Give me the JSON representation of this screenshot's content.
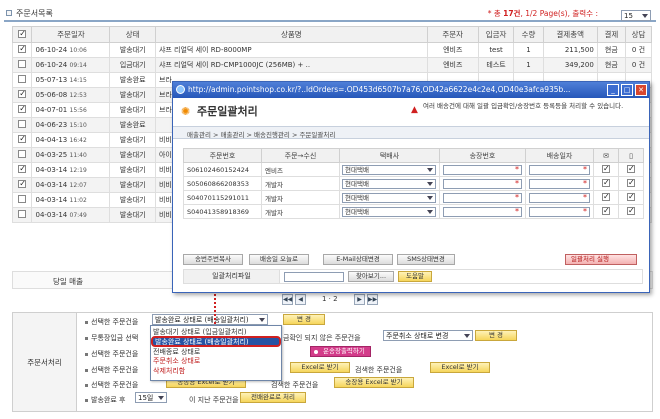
{
  "header": {
    "title": "주문서목록",
    "total_prefix": "* 총 ",
    "total_count": "17건",
    "total_pages": ", 1/2 Page(s), 출력수 : ",
    "per_page": "15"
  },
  "table": {
    "columns": [
      "주문일자",
      "상태",
      "상품명",
      "주문자",
      "입금자",
      "수량",
      "결제총액",
      "결제",
      "상담"
    ],
    "rows": [
      {
        "checked": true,
        "date": "06-10-24",
        "time": "10:06",
        "status": "발송대기",
        "product": "샤프 리얼덕 세이 RD-8000MP",
        "buyer": "엔비즈",
        "payer": "test",
        "qty": "1",
        "total": "211,500",
        "pay": "현금",
        "memo": "0 건"
      },
      {
        "checked": false,
        "date": "06-10-24",
        "time": "09:14",
        "status": "입금대기",
        "product": "샤프 리얼덕 세이 RD-CMP1000JC (256MB) + ..",
        "buyer": "엔비즈",
        "payer": "테스트",
        "qty": "1",
        "total": "349,200",
        "pay": "현금",
        "memo": "0 건"
      },
      {
        "checked": false,
        "date": "05-07-13",
        "time": "14:15",
        "status": "발송완료",
        "product": "브라",
        "buyer": "",
        "payer": "",
        "qty": "",
        "total": "",
        "pay": "",
        "memo": ""
      },
      {
        "checked": true,
        "date": "05-06-08",
        "time": "12:53",
        "status": "발송대기",
        "product": "브라",
        "buyer": "",
        "payer": "",
        "qty": "",
        "total": "",
        "pay": "",
        "memo": ""
      },
      {
        "checked": true,
        "date": "04-07-01",
        "time": "15:56",
        "status": "발송대기",
        "product": "브라",
        "buyer": "",
        "payer": "",
        "qty": "",
        "total": "",
        "pay": "",
        "memo": ""
      },
      {
        "checked": false,
        "date": "04-06-23",
        "time": "15:10",
        "status": "발송완료",
        "product": "",
        "buyer": "",
        "payer": "",
        "qty": "",
        "total": "",
        "pay": "",
        "memo": ""
      },
      {
        "checked": true,
        "date": "04-04-13",
        "time": "16:42",
        "status": "발송대기",
        "product": "비비",
        "buyer": "",
        "payer": "",
        "qty": "",
        "total": "",
        "pay": "",
        "memo": ""
      },
      {
        "checked": false,
        "date": "04-03-25",
        "time": "11:40",
        "status": "발송대기",
        "product": "아이",
        "buyer": "",
        "payer": "",
        "qty": "",
        "total": "",
        "pay": "",
        "memo": ""
      },
      {
        "checked": true,
        "date": "04-03-14",
        "time": "12:19",
        "status": "발송대기",
        "product": "비비",
        "buyer": "",
        "payer": "",
        "qty": "",
        "total": "",
        "pay": "",
        "memo": ""
      },
      {
        "checked": true,
        "date": "04-03-14",
        "time": "12:07",
        "status": "발송대기",
        "product": "비비",
        "buyer": "",
        "payer": "",
        "qty": "",
        "total": "",
        "pay": "",
        "memo": ""
      },
      {
        "checked": false,
        "date": "04-03-14",
        "time": "11:02",
        "status": "발송대기",
        "product": "비비",
        "buyer": "",
        "payer": "",
        "qty": "",
        "total": "",
        "pay": "",
        "memo": ""
      },
      {
        "checked": false,
        "date": "04-03-14",
        "time": "07:49",
        "status": "발송대기",
        "product": "비비",
        "buyer": "",
        "payer": "",
        "qty": "",
        "total": "",
        "pay": "",
        "memo": ""
      }
    ]
  },
  "sales_label": "당일 매출",
  "pager": {
    "first": "◀◀",
    "prev": "◀",
    "pages": "1 · 2",
    "next": "▶",
    "last": "▶▶"
  },
  "process": {
    "section_label": "주문서처리",
    "row1_label": "선택한 주문건을",
    "row1_select": "발송완료 상태로 (배송일괄처리)",
    "change_btn": "변 경",
    "row2_label": "무통장입금 선택",
    "row2_mid": "금확인 되지 않은 주문건을",
    "row2_select": "주문취소 상태로 변경",
    "row3_label": "선택한 주문건을",
    "row3_pink": "운송장출력하기",
    "row4_label": "선택한 주문건을",
    "row4_excel": "Excel로 받기",
    "row4_mid": "검색한 주문건을",
    "row4_excel2": "Excel로 받기",
    "row5_label": "선택한 주문건을",
    "row5_btn": "송장용 Excel로 받기",
    "row5_mid": "검색한 주문건을",
    "row5_btn2": "송장용 Excel로 받기",
    "row6_label": "발송완료 후",
    "row6_select": "15일",
    "row6_mid": "이 지난 주문건을",
    "row6_btn": "전배완료로 처리"
  },
  "dropdown_options": [
    "발송대기 상태로 (입금일괄처리)",
    "발송완료 상태로 (배송일괄처리)",
    "전배종료 상태로",
    "주문취소 상태로",
    "삭제처리함"
  ],
  "popup": {
    "url": "http://admin.pointshop.co.kr/?..ldOrders=.OD453d6507b7a76,OD42a6622e4c2e4,OD40e3afca935b...",
    "title": "주문일괄처리",
    "note": "여러 배송건에 대해 일괄 입금확인/송장번호 등록등을 처리할 수 있습니다.",
    "breadcrumb": "매출관리 > 매출관리 > 배송진행관리 > 주문일괄처리",
    "columns": [
      "주문번호",
      "주문→수신",
      "택배사",
      "송장번호",
      "배송일자"
    ],
    "rows": [
      {
        "order": "S06102460152424",
        "name": "엔비즈",
        "courier": "현대택배"
      },
      {
        "order": "S05060866208353",
        "name": "개발자",
        "courier": "현대택배"
      },
      {
        "order": "S04070115291011",
        "name": "개발자",
        "courier": "현대택배"
      },
      {
        "order": "S04041358918369",
        "name": "개발자",
        "courier": "현대택배"
      }
    ],
    "btn_copy": "송번주번복사",
    "btn_today": "배송일 오늘로",
    "btn_email": "E-Mail상태변경",
    "btn_sms": "SMS상태변경",
    "btn_run": "일괄처리 실행",
    "file_label": "일괄처리파일",
    "btn_browse": "찾아보기...",
    "btn_help": "도움말"
  }
}
